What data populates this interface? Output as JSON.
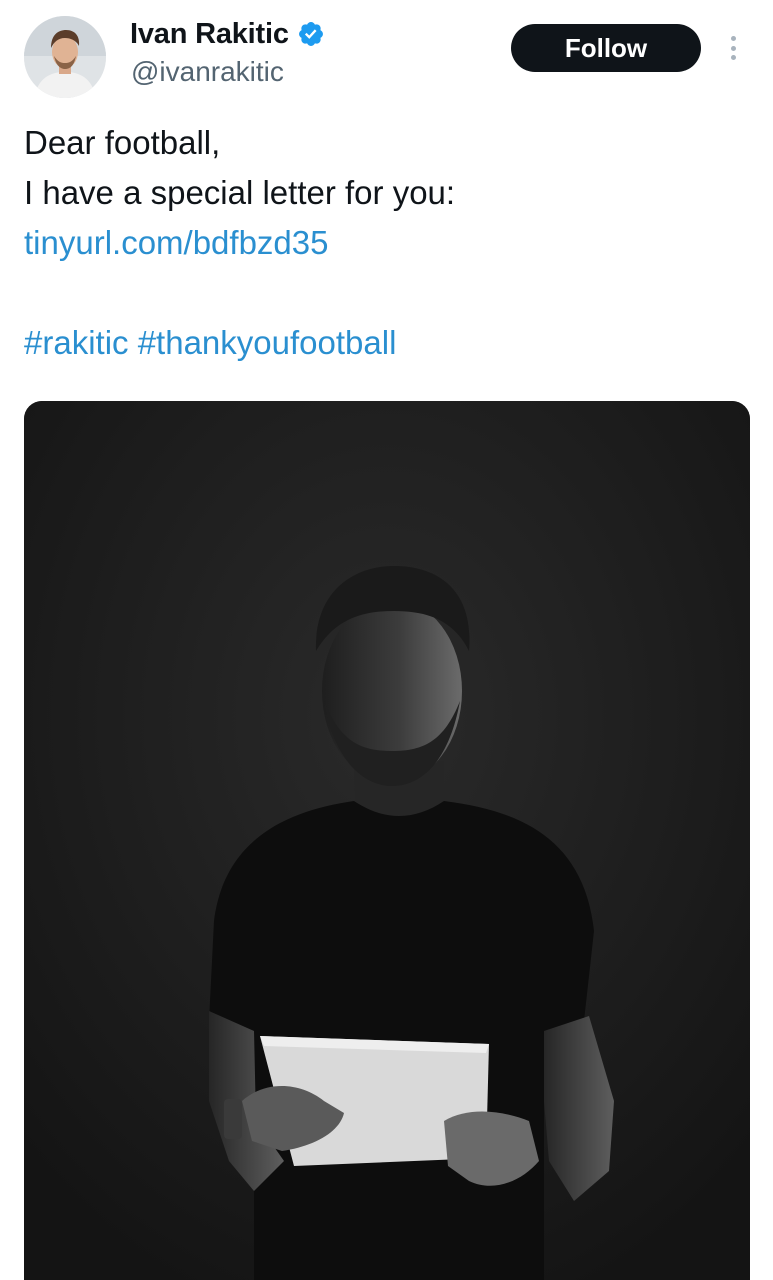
{
  "author": {
    "display_name": "Ivan Rakitic",
    "handle": "@ivanrakitic",
    "verified": true,
    "verified_color": "#1d9bf0"
  },
  "actions": {
    "follow_label": "Follow",
    "more_icon": "more-vertical-icon"
  },
  "tweet": {
    "line1": "Dear football,",
    "line2": "I have a special letter for you:",
    "link": "tinyurl.com/bdfbzd35",
    "hashtags": [
      "#rakitic",
      "#thankyoufootball"
    ]
  },
  "colors": {
    "link": "#2a8fd0",
    "text": "#0f1419",
    "secondary": "#536471",
    "button_bg": "#0f1419",
    "button_text": "#ffffff"
  }
}
